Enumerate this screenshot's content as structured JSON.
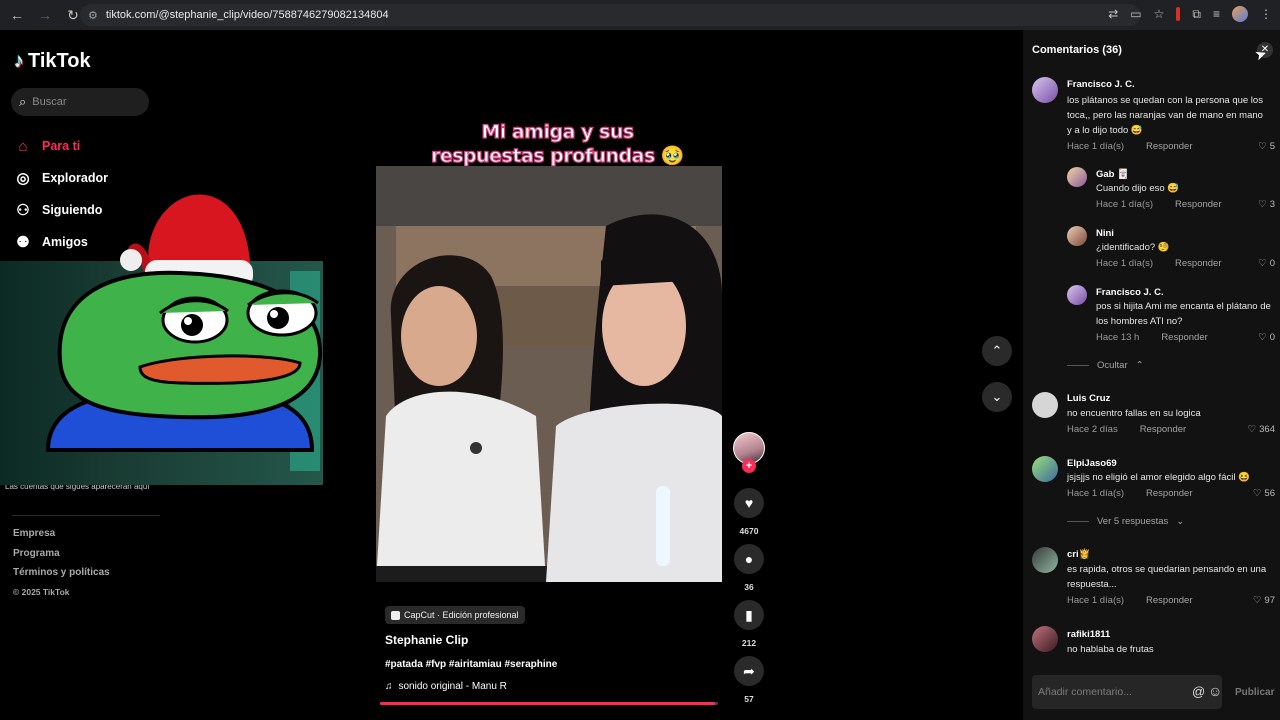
{
  "browser": {
    "url": "tiktok.com/@stephanie_clip/video/7588746279082134804"
  },
  "sidebar": {
    "logo": "TikTok",
    "search_placeholder": "Buscar",
    "items": [
      {
        "label": "Para ti",
        "icon": "home-icon"
      },
      {
        "label": "Explorador",
        "icon": "compass-icon"
      },
      {
        "label": "Siguiendo",
        "icon": "following-icon"
      },
      {
        "label": "Amigos",
        "icon": "friends-icon"
      }
    ],
    "follow_note": "Las cuentas que sigues aparecerán aquí",
    "footer": [
      "Empresa",
      "Programa",
      "Términos y políticas"
    ],
    "copyright": "© 2025 TikTok"
  },
  "video": {
    "overlay_caption": "Mi amiga y sus respuestas profundas 🥹",
    "capcut_label": "CapCut · Edición profesional",
    "author": "Stephanie Clip",
    "hashtags": "#patada #fvp #airitamiau #seraphine",
    "sound": "sonido original - Manu R",
    "progress_fraction": 0.99,
    "likes": "4670",
    "comments": "36",
    "saves": "212",
    "shares": "57"
  },
  "comments_panel": {
    "title": "Comentarios (36)",
    "hide_label": "Ocultar",
    "view_replies_label": "Ver 5 respuestas",
    "input_placeholder": "Añadir comentario...",
    "publish_label": "Publicar",
    "reply_label": "Responder",
    "items": [
      {
        "name": "Francisco J. C.",
        "text": "los plátanos se quedan con la persona que los toca,, pero las naranjas van de mano en mano y a lo dijo todo 😅",
        "time": "Hace 1 día(s)",
        "likes": "5"
      },
      {
        "name": "Gab 🃏",
        "text": "Cuando dijo eso 😅",
        "time": "Hace 1 día(s)",
        "likes": "3"
      },
      {
        "name": "Nini",
        "text": "¿identificado? 🧐",
        "time": "Hace 1 día(s)",
        "likes": "0"
      },
      {
        "name": "Francisco J. C.",
        "text": "pos si hijita Ami me encanta el plátano de los hombres ATI no?",
        "time": "Hace 13 h",
        "likes": "0"
      },
      {
        "name": "Luis Cruz",
        "text": "no encuentro fallas en su logica",
        "time": "Hace 2 días",
        "likes": "364"
      },
      {
        "name": "ElpiJaso69",
        "text": "jsjsjjs no eligió el amor elegido algo fácil 😆",
        "time": "Hace 1 día(s)",
        "likes": "56"
      },
      {
        "name": "cri👸",
        "text": "es rapida, otros se quedarian pensando en una respuesta...",
        "time": "Hace 1 día(s)",
        "likes": "97"
      },
      {
        "name": "rafiki1811",
        "text": "no hablaba de frutas",
        "time": "",
        "likes": ""
      }
    ]
  }
}
